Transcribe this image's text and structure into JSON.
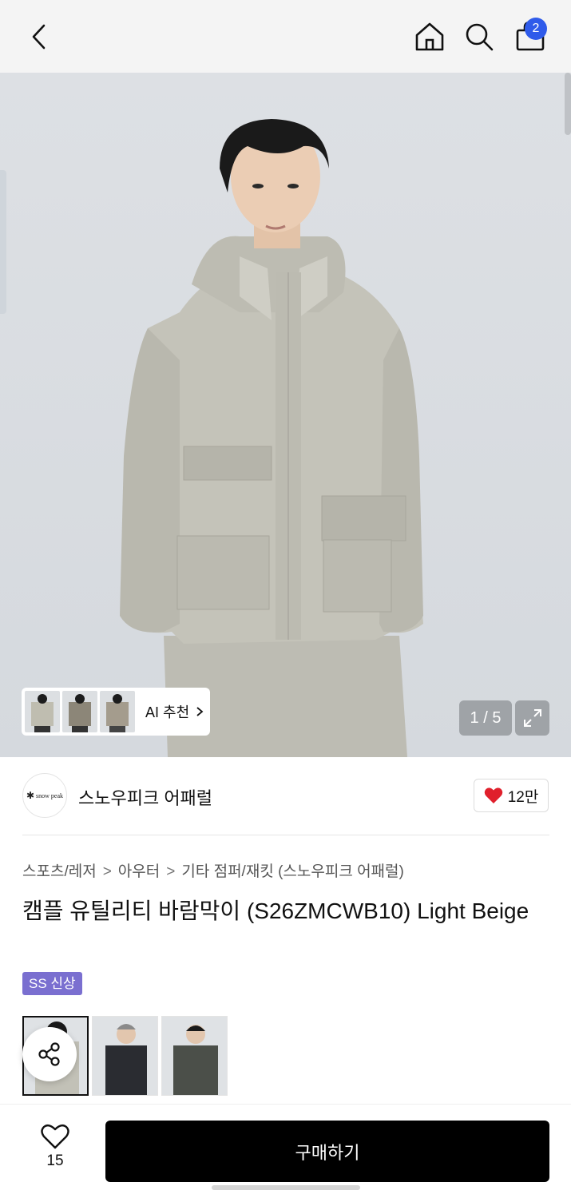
{
  "header": {
    "cart_count": "2"
  },
  "gallery": {
    "counter": "1 / 5",
    "ai_label": "AI 추천",
    "model_colors": {
      "background": "#d9dce0",
      "jacket": "#c2c1b7",
      "hair": "#1a1a1a",
      "skin": "#e9cbb2"
    }
  },
  "brand": {
    "logo_text": "snow peak",
    "name": "스노우피크 어패럴",
    "likes": "12만"
  },
  "breadcrumb": [
    "스포츠/레저",
    "아우터",
    "기타 점퍼/재킷 (스노우피크 어패럴)"
  ],
  "product": {
    "title": "캠플 유틸리티 바람막이 (S26ZMCWB10) Light Beige",
    "tag": "SS 신상"
  },
  "colors": {
    "accent_blue": "#2f5bea",
    "tag_purple": "#7a6fd0",
    "heart_red": "#e0202c",
    "buy_black": "#000000"
  },
  "bottom_bar": {
    "wish_count": "15",
    "buy_label": "구매하기"
  }
}
